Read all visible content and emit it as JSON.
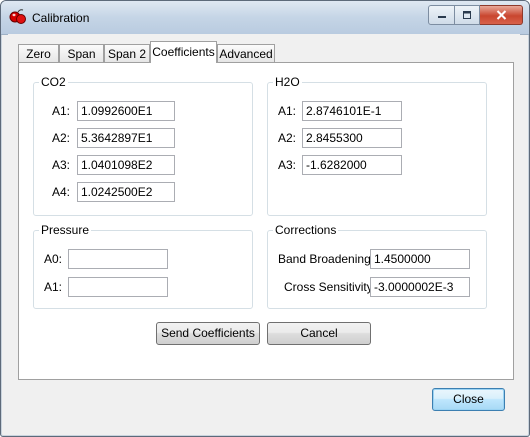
{
  "window": {
    "title": "Calibration"
  },
  "tabs": [
    {
      "label": "Zero"
    },
    {
      "label": "Span"
    },
    {
      "label": "Span 2"
    },
    {
      "label": "Coefficients"
    },
    {
      "label": "Advanced"
    }
  ],
  "active_tab": "Coefficients",
  "co2": {
    "title": "CO2",
    "rows": [
      {
        "label": "A1:",
        "value": "1.0992600E1"
      },
      {
        "label": "A2:",
        "value": "5.3642897E1"
      },
      {
        "label": "A3:",
        "value": "1.0401098E2"
      },
      {
        "label": "A4:",
        "value": "1.0242500E2"
      }
    ]
  },
  "h2o": {
    "title": "H2O",
    "rows": [
      {
        "label": "A1:",
        "value": "2.8746101E-1"
      },
      {
        "label": "A2:",
        "value": "2.8455300"
      },
      {
        "label": "A3:",
        "value": "-1.6282000"
      }
    ]
  },
  "pressure": {
    "title": "Pressure",
    "rows": [
      {
        "label": "A0:",
        "value": ""
      },
      {
        "label": "A1:",
        "value": ""
      }
    ]
  },
  "corrections": {
    "title": "Corrections",
    "rows": [
      {
        "label": "Band Broadening:",
        "value": "1.4500000"
      },
      {
        "label": "Cross Sensitivity:",
        "value": "-3.0000002E-3"
      }
    ]
  },
  "buttons": {
    "send": "Send Coefficients",
    "cancel": "Cancel",
    "close": "Close"
  }
}
